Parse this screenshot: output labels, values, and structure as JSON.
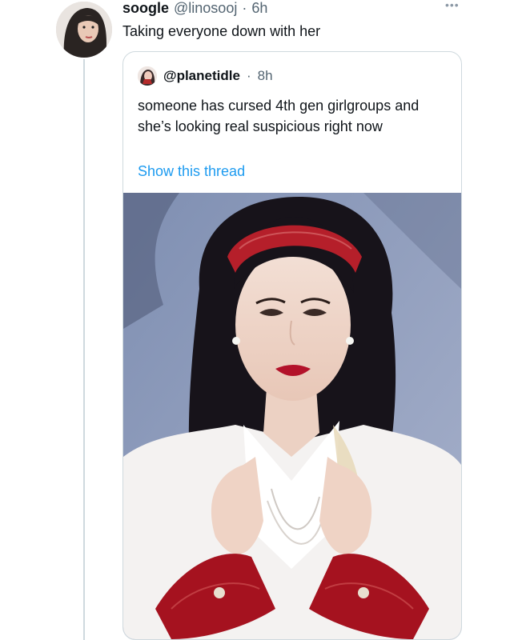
{
  "tweet": {
    "display_name": "soogle",
    "handle": "@linosooj",
    "separator": "·",
    "time": "6h",
    "text": "Taking everyone down with her",
    "more_icon": "more-horizontal-icon"
  },
  "quoted_tweet": {
    "handle": "@planetidle",
    "separator": "·",
    "time": "8h",
    "text": "someone has cursed 4th gen girlgroups and she’s looking real suspicious right now",
    "show_thread_label": "Show this thread",
    "media": "photo"
  },
  "colors": {
    "link": "#1d9bf0",
    "text": "#0f1419",
    "secondary": "#536471",
    "border": "#cfd9de"
  }
}
